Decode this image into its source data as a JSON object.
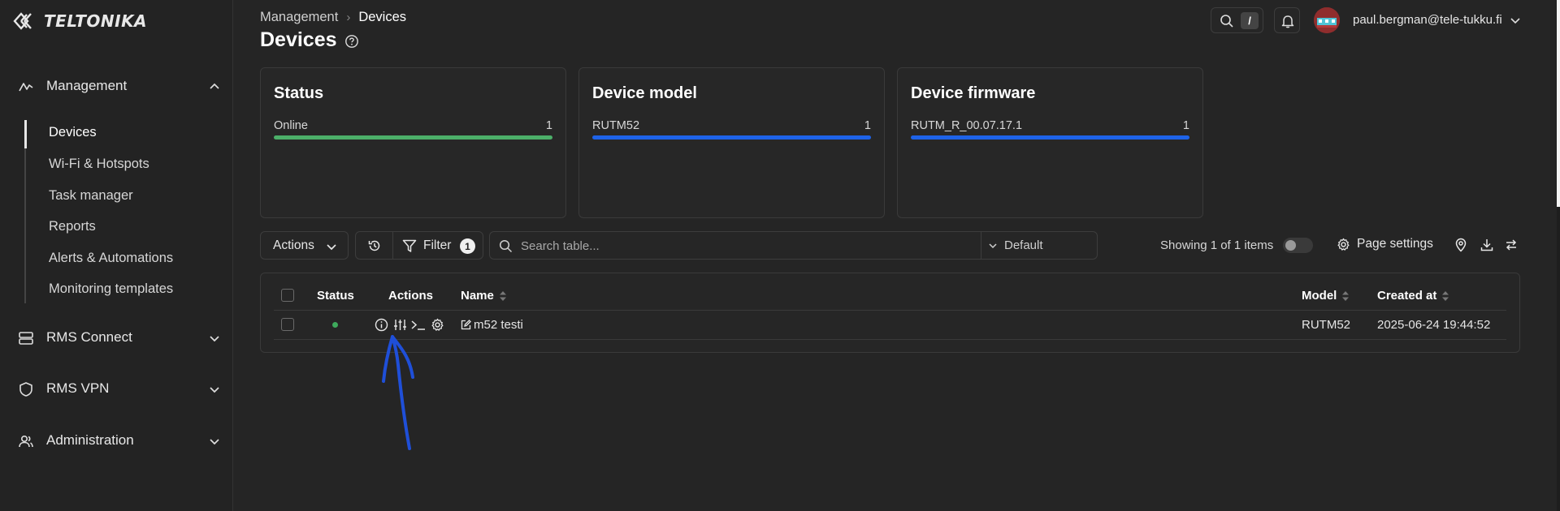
{
  "brand": {
    "name": "TELTONIKA"
  },
  "sidebar": {
    "sections": [
      {
        "label": "Management",
        "icon": "activity-icon",
        "expanded": true
      },
      {
        "label": "RMS Connect",
        "icon": "server-icon",
        "expanded": false
      },
      {
        "label": "RMS VPN",
        "icon": "shield-icon",
        "expanded": false
      },
      {
        "label": "Administration",
        "icon": "users-icon",
        "expanded": false
      }
    ],
    "management_items": [
      {
        "label": "Devices",
        "active": true
      },
      {
        "label": "Wi-Fi & Hotspots"
      },
      {
        "label": "Task manager"
      },
      {
        "label": "Reports"
      },
      {
        "label": "Alerts & Automations"
      },
      {
        "label": "Monitoring templates"
      }
    ]
  },
  "header": {
    "breadcrumb": [
      "Management",
      "Devices"
    ],
    "title": "Devices",
    "search_shortcut": "/",
    "user_email": "paul.bergman@tele-tukku.fi"
  },
  "cards": [
    {
      "title": "Status",
      "label": "Online",
      "count": "1",
      "bar_color": "#4caf69",
      "fill_fraction": 1.0
    },
    {
      "title": "Device model",
      "label": "RUTM52",
      "count": "1",
      "bar_color": "#1e63e8",
      "fill_fraction": 1.0
    },
    {
      "title": "Device firmware",
      "label": "RUTM_R_00.07.17.1",
      "count": "1",
      "bar_color": "#1e63e8",
      "fill_fraction": 1.0
    }
  ],
  "toolbar": {
    "actions_label": "Actions",
    "filter_label": "Filter",
    "filter_count": "1",
    "search_placeholder": "Search table...",
    "view_label": "Default",
    "showing": "Showing 1 of 1 items",
    "page_settings": "Page settings"
  },
  "table": {
    "columns": [
      "Status",
      "Actions",
      "Name",
      "Model",
      "Created at"
    ],
    "rows": [
      {
        "status": "online",
        "name": "m52 testi",
        "model": "RUTM52",
        "created_at": "2025-06-24 19:44:52"
      }
    ]
  },
  "colors": {
    "accent_blue": "#1e63e8",
    "online_green": "#3eaa5c",
    "annotation": "#1f4fd8"
  }
}
